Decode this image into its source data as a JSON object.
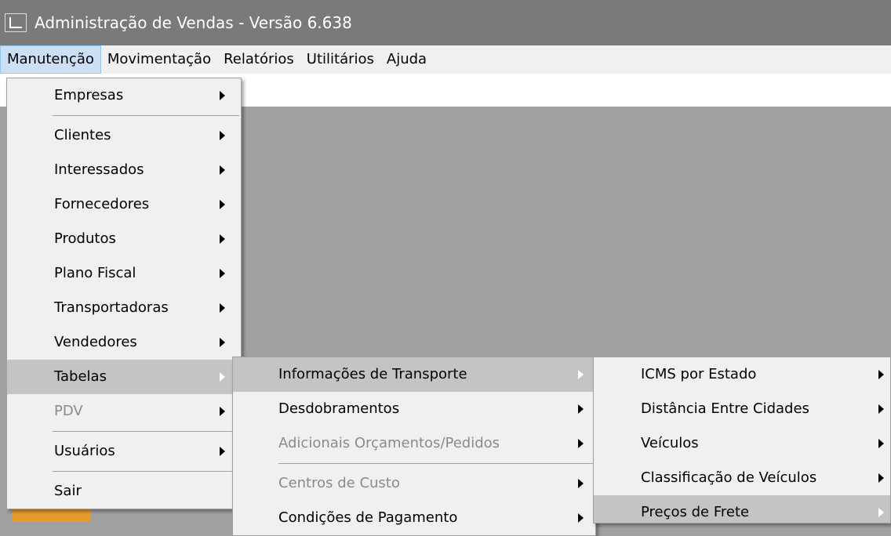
{
  "window": {
    "title": "Administração de Vendas - Versão 6.638"
  },
  "menubar": {
    "items": [
      "Manutenção",
      "Movimentação",
      "Relatórios",
      "Utilitários",
      "Ajuda"
    ]
  },
  "menu_manutencao": {
    "empresas": "Empresas",
    "clientes": "Clientes",
    "interessados": "Interessados",
    "fornecedores": "Fornecedores",
    "produtos": "Produtos",
    "plano_fiscal": "Plano Fiscal",
    "transportadoras": "Transportadoras",
    "vendedores": "Vendedores",
    "tabelas": "Tabelas",
    "pdv": "PDV",
    "usuarios": "Usuários",
    "sair": "Sair"
  },
  "menu_tabelas": {
    "informacoes_transporte": "Informações de Transporte",
    "desdobramentos": "Desdobramentos",
    "adicionais": "Adicionais Orçamentos/Pedidos",
    "centros_custo": "Centros de Custo",
    "condicoes_pagamento": "Condições de Pagamento"
  },
  "menu_transporte": {
    "icms": "ICMS por Estado",
    "distancia": "Distância Entre Cidades",
    "veiculos": "Veículos",
    "classificacao": "Classificação de Veículos",
    "precos_frete": "Preços de Frete"
  }
}
